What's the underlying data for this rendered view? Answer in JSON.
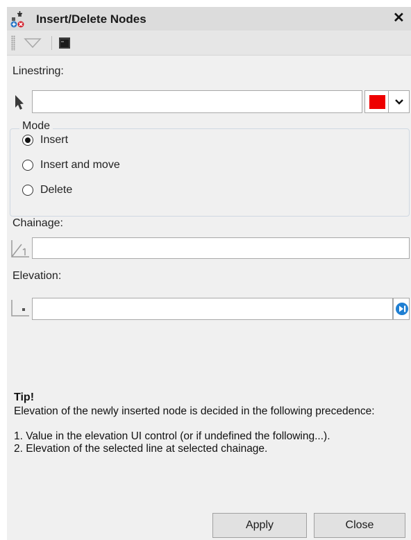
{
  "window": {
    "title": "Insert/Delete Nodes",
    "close_glyph": "✕"
  },
  "toolbar": {
    "items": [
      "triangle-dropdown-icon",
      "console-window-icon"
    ]
  },
  "linestring": {
    "label": "Linestring:",
    "value": "",
    "color": "#ee0000"
  },
  "mode": {
    "label": "Mode",
    "options": [
      {
        "label": "Insert",
        "checked": true
      },
      {
        "label": "Insert and move",
        "checked": false
      },
      {
        "label": "Delete",
        "checked": false
      }
    ]
  },
  "chainage": {
    "label": "Chainage:",
    "value": ""
  },
  "elevation": {
    "label": "Elevation:",
    "value": ""
  },
  "tip": {
    "title": "Tip!",
    "text": "Elevation of the newly inserted node is decided in the following precedence:",
    "lines": [
      " 1. Value in the elevation UI control (or if undefined the following...).",
      " 2. Elevation of the selected line at selected chainage."
    ]
  },
  "buttons": {
    "apply": "Apply",
    "close": "Close"
  }
}
